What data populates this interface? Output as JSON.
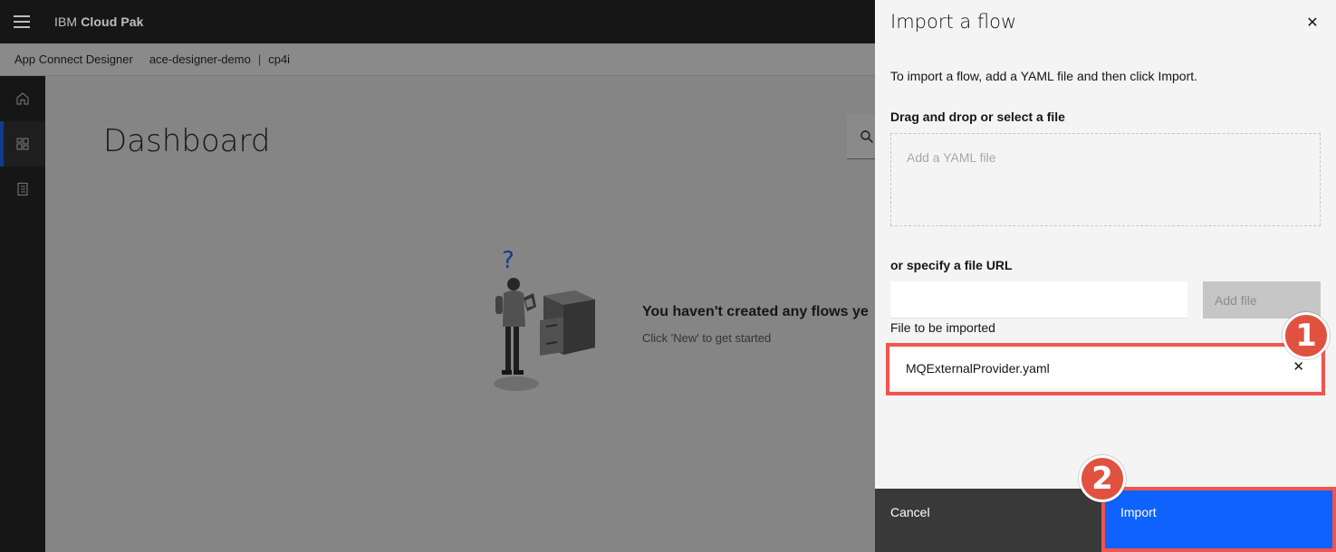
{
  "header": {
    "brand_prefix": "IBM",
    "brand_name": "Cloud Pak"
  },
  "subheader": {
    "app": "App Connect Designer",
    "instance": "ace-designer-demo",
    "separator": "|",
    "namespace": "cp4i"
  },
  "sidebar": {
    "items": [
      {
        "icon": "home-icon"
      },
      {
        "icon": "dashboard-icon",
        "active": true
      },
      {
        "icon": "catalog-icon"
      }
    ]
  },
  "main": {
    "title": "Dashboard",
    "empty_heading": "You haven't created any flows ye",
    "empty_sub": "Click 'New' to get started"
  },
  "panel": {
    "title": "Import a flow",
    "description": "To import a flow, add a YAML file and then click Import.",
    "drop_label": "Drag and drop or select a file",
    "drop_placeholder": "Add a YAML file",
    "url_label": "or specify a file URL",
    "url_value": "",
    "add_file_label": "Add file",
    "file_label": "File to be imported",
    "file_name": "MQExternalProvider.yaml",
    "cancel_label": "Cancel",
    "import_label": "Import"
  },
  "annotations": {
    "step1": "1",
    "step2": "2"
  },
  "colors": {
    "accent": "#0f62fe",
    "highlight": "#f0554e",
    "badge": "#e0523f"
  }
}
